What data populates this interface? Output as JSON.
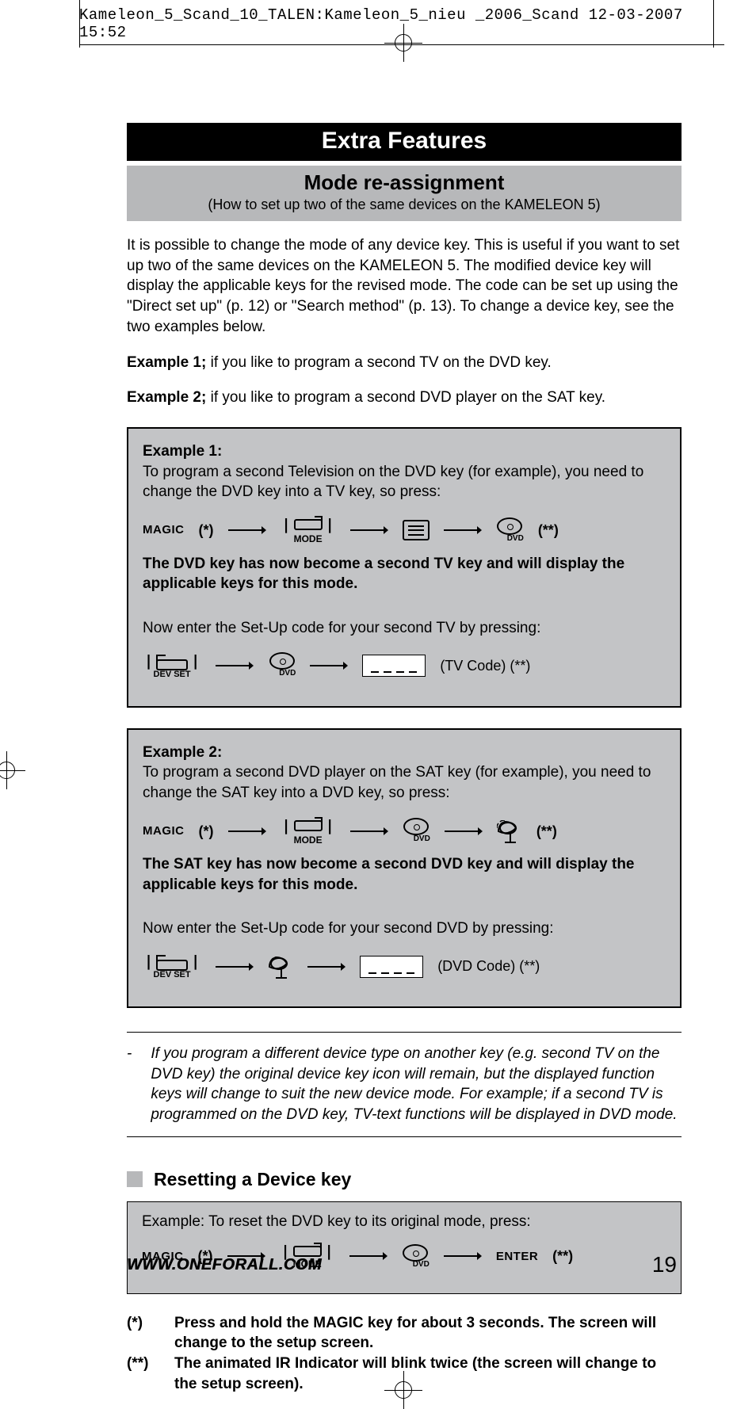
{
  "header": {
    "text": "Kameleon_5_Scand_10_TALEN:Kameleon_5_nieu _2006_Scand  12-03-2007  15:52"
  },
  "title": "Extra Features",
  "subtitle": {
    "heading": "Mode re-assignment",
    "caption": "(How to set up two of the same devices on the KAMELEON 5)"
  },
  "intro": "It is possible to change the mode of any device key. This is useful if you want to set up two of the same devices on the KAMELEON 5. The modified device key will display the applicable keys for the revised mode. The code can be set up using the \"Direct set up\" (p. 12) or \"Search method\" (p. 13). To change a device key, see the two examples below.",
  "example_intro_1": {
    "label": "Example 1;",
    "text": " if you like to program a second TV on the DVD key."
  },
  "example_intro_2": {
    "label": "Example 2;",
    "text": " if you like to program a second DVD player on the SAT key."
  },
  "example1": {
    "title": "Example 1:",
    "desc": "To program a second Television on the DVD key (for example), you need to change the DVD key into a TV key, so press:",
    "magic": "MAGIC",
    "star": "(*)",
    "mode": "MODE",
    "dvd": "DVD",
    "doublestar": "(**)",
    "result": "The DVD key has now become a second TV key and will display the applicable keys for this mode.",
    "setup": "Now enter the Set-Up code for your second TV by pressing:",
    "devset": "DEV SET",
    "code_label": "(TV Code)  (**)"
  },
  "example2": {
    "title": "Example 2:",
    "desc": "To program a second DVD player on the SAT key (for example), you need to change the SAT key into a DVD key, so press:",
    "magic": "MAGIC",
    "star": "(*)",
    "mode": "MODE",
    "dvd": "DVD",
    "doublestar": "(**)",
    "result": "The SAT key has now become a second DVD key and will display the applicable keys for this mode.",
    "setup": "Now enter the Set-Up code for your second DVD by pressing:",
    "devset": "DEV SET",
    "code_label": "(DVD Code) (**)"
  },
  "note": {
    "dash": "-",
    "text": "If you program a different device type on another key (e.g. second TV on the DVD key) the original device key icon will remain, but the displayed function keys will change to suit the new device mode. For example; if a second TV is programmed on the DVD key, TV-text functions will be displayed in DVD mode."
  },
  "reset": {
    "heading": "Resetting a Device key",
    "desc": "Example: To reset the DVD key to its original mode, press:",
    "magic": "MAGIC",
    "star": "(*)",
    "mode": "MODE",
    "dvd": "DVD",
    "enter": "ENTER",
    "doublestar": "(**)"
  },
  "footnotes": {
    "a": {
      "mark": "(*)",
      "text": "Press and hold the MAGIC key for about 3 seconds. The screen will change to the setup screen."
    },
    "b": {
      "mark": "(**)",
      "text": "The animated IR Indicator will blink twice (the screen will change to the setup screen)."
    }
  },
  "footer": {
    "url": "WWW.ONEFORALL.COM",
    "page": "19"
  }
}
